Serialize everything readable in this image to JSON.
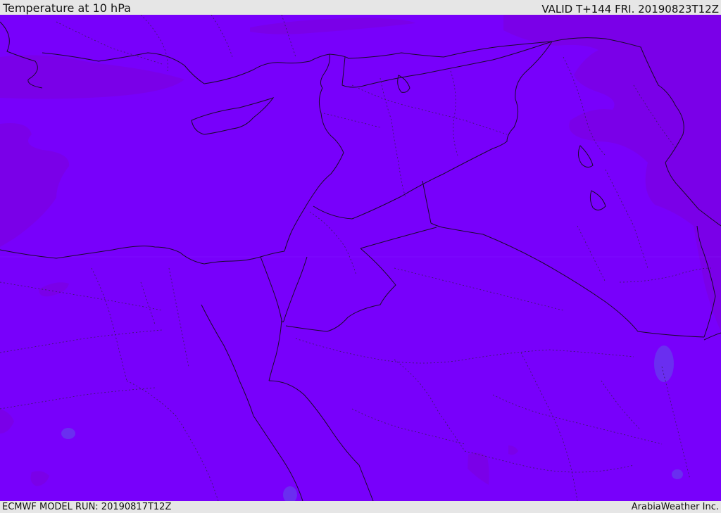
{
  "header": {
    "title": "Temperature at 10 hPa",
    "valid": "VALID T+144 FRI. 20190823T12Z"
  },
  "footer": {
    "model_run": "ECMWF MODEL RUN: 20190817T12Z",
    "credit": "ArabiaWeather Inc."
  },
  "map": {
    "colors": {
      "base_fill": "#7800fb",
      "cool_band": "#7a00e8",
      "warm_patch": "#6a2ef0",
      "border_line": "#1a0a2a",
      "admin_line": "#3a1a60"
    }
  }
}
